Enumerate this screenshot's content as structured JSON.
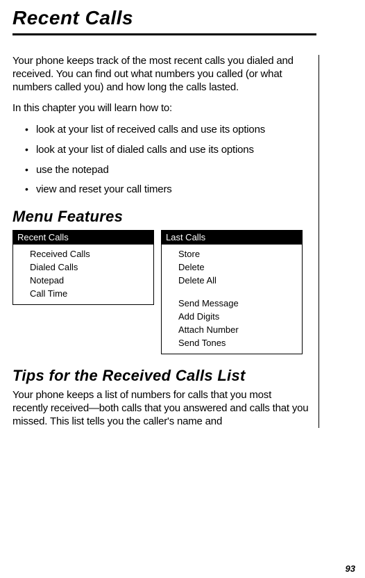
{
  "page": {
    "title": "Recent Calls",
    "intro": "Your phone keeps track of the most recent calls you dialed and received. You can find out what numbers you called (or what numbers called you) and how long the calls lasted.",
    "lead_in": "In this chapter you will learn how to:",
    "bullets": [
      "look at your list of received calls and use its options",
      "look at your list of dialed calls and use its options",
      "use the notepad",
      "view and reset your call timers"
    ],
    "section_menu_features": "Menu Features",
    "menu_left": {
      "header": "Recent Calls",
      "items": [
        "Received Calls",
        "Dialed Calls",
        "Notepad",
        "Call Time"
      ]
    },
    "menu_right": {
      "header": "Last Calls",
      "items_top": [
        "Store",
        "Delete",
        "Delete All"
      ],
      "items_bottom": [
        "Send Message",
        "Add Digits",
        "Attach Number",
        "Send Tones"
      ]
    },
    "section_tips": "Tips for the Received Calls List",
    "tips_para": "Your phone keeps a list of numbers for calls that you most recently received—both calls that you answered and calls that you missed. This list tells you the caller's name and",
    "page_number": "93"
  }
}
